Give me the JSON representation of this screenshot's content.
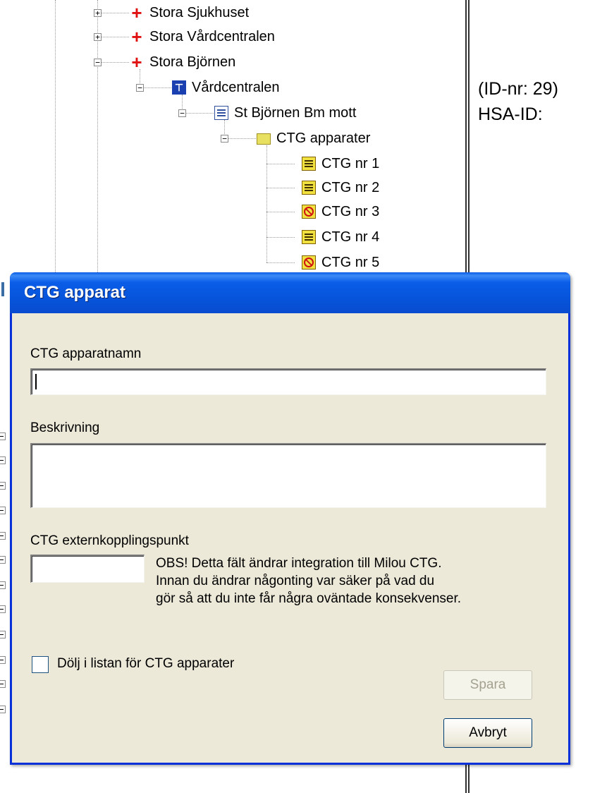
{
  "tree": {
    "items": [
      {
        "label": "Stora Sjukhuset",
        "icon": "red-cross-icon",
        "expander": "+"
      },
      {
        "label": "Stora Vårdcentralen",
        "icon": "red-cross-icon",
        "expander": "+"
      },
      {
        "label": "Stora Björnen",
        "icon": "red-cross-icon",
        "expander": "−"
      },
      {
        "label": "Vårdcentralen",
        "icon": "unit-icon",
        "expander": "−"
      },
      {
        "label": "St Björnen Bm mott",
        "icon": "document-icon",
        "expander": "−"
      },
      {
        "label": "CTG apparater",
        "icon": "folder-icon",
        "expander": "−"
      },
      {
        "label": "CTG nr 1",
        "icon": "ctg-active-icon"
      },
      {
        "label": "CTG nr 2",
        "icon": "ctg-active-icon"
      },
      {
        "label": "CTG nr 3",
        "icon": "ctg-disabled-icon"
      },
      {
        "label": "CTG nr 4",
        "icon": "ctg-active-icon"
      },
      {
        "label": "CTG nr 5",
        "icon": "ctg-disabled-icon"
      }
    ]
  },
  "info": {
    "id_line": "(ID-nr:  29)",
    "hsa_line": "HSA-ID:"
  },
  "dialog": {
    "title": "CTG apparat",
    "name_label": "CTG apparatnamn",
    "name_value": "",
    "description_label": "Beskrivning",
    "description_value": "",
    "external_label": "CTG externkopplingspunkt",
    "external_value": "",
    "warning_lines": [
      "OBS! Detta fält ändrar integration till Milou CTG.",
      "Innan du ändrar någonting var säker på vad du",
      "gör så att du inte får några oväntade konsekvenser."
    ],
    "hide_checkbox_label": "Dölj i listan för CTG apparater",
    "hide_checked": false,
    "save_button": "Spara",
    "save_enabled": false,
    "cancel_button": "Avbryt"
  },
  "colors": {
    "titlebar": "#0a5ce8",
    "dialog_bg": "#ece9d8",
    "error_red": "#e01010"
  }
}
